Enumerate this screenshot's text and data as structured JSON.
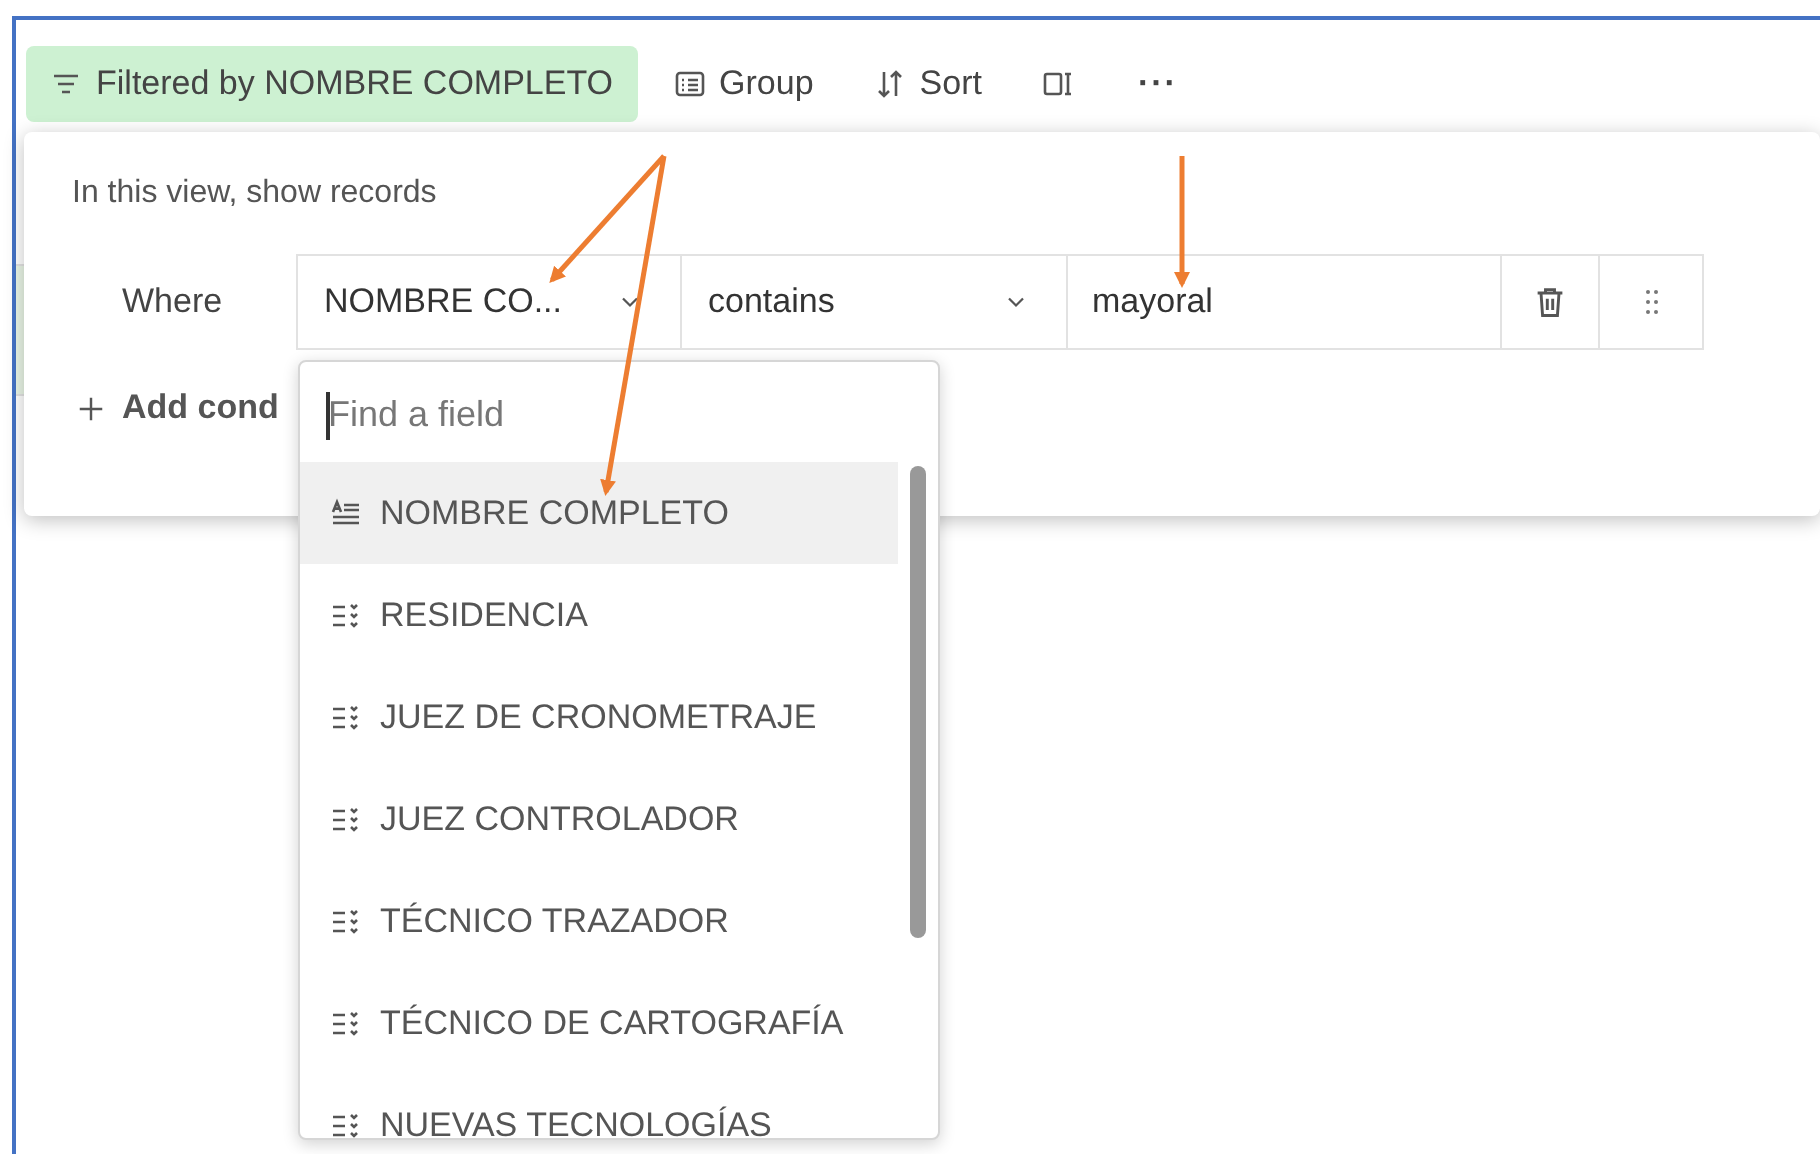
{
  "toolbar": {
    "filter_button": {
      "label": "Filtered by NOMBRE COMPLETO",
      "active": true
    },
    "buttons": [
      {
        "kind": "group",
        "label": "Group"
      },
      {
        "kind": "sort",
        "label": "Sort"
      },
      {
        "kind": "columns"
      },
      {
        "kind": "more",
        "label": "···"
      }
    ]
  },
  "filter_popover": {
    "heading": "In this view, show records",
    "condition": {
      "label": "Where",
      "field": "NOMBRE CO...",
      "operator": "contains",
      "value": "mayoral"
    },
    "add_condition": "Add cond"
  },
  "field_dropdown": {
    "search": {
      "placeholder": "Find a field"
    },
    "items": [
      {
        "kind": "text",
        "label": "NOMBRE COMPLETO",
        "selected": true
      },
      {
        "kind": "select",
        "label": "RESIDENCIA",
        "selected": false
      },
      {
        "kind": "select",
        "label": "JUEZ DE CRONOMETRAJE",
        "selected": false
      },
      {
        "kind": "select",
        "label": "JUEZ CONTROLADOR",
        "selected": false
      },
      {
        "kind": "select",
        "label": "TÉCNICO TRAZADOR",
        "selected": false
      },
      {
        "kind": "select",
        "label": "TÉCNICO DE CARTOGRAFÍA",
        "selected": false
      },
      {
        "kind": "select",
        "label": "NUEVAS TECNOLOGÍAS",
        "selected": false
      }
    ]
  }
}
